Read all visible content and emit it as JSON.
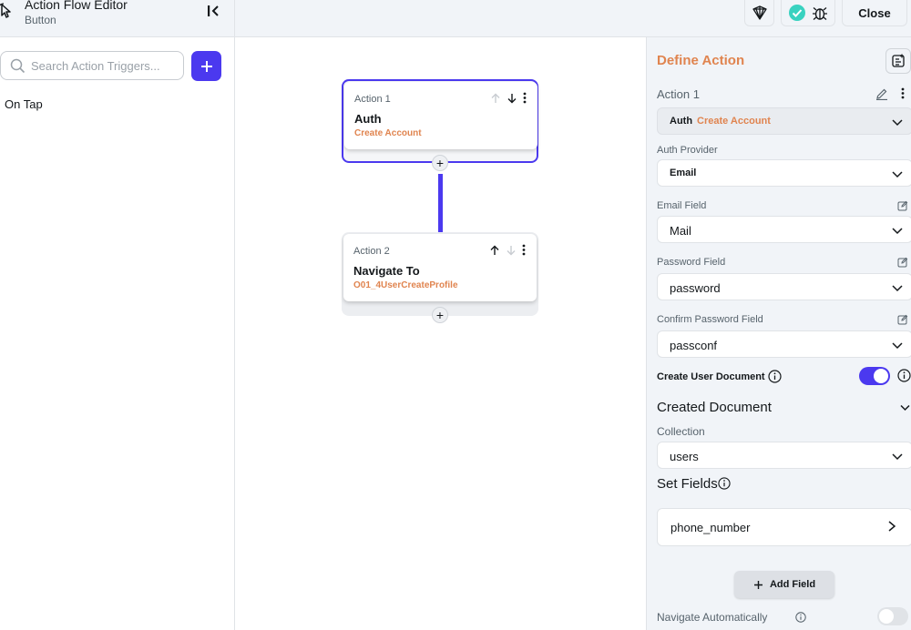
{
  "header": {
    "title": "Action Flow Editor",
    "subtitle": "Button",
    "close_label": "Close"
  },
  "left": {
    "search_placeholder": "Search Action Triggers...",
    "triggers": [
      "On Tap"
    ]
  },
  "canvas": {
    "actions": [
      {
        "num": "Action 1",
        "title": "Auth",
        "sub": "Create Account"
      },
      {
        "num": "Action 2",
        "title": "Navigate To",
        "sub": "O01_4UserCreateProfile"
      }
    ]
  },
  "panel": {
    "title": "Define Action",
    "action_label": "Action 1",
    "action_type": "Auth",
    "action_type_sub": "Create Account",
    "auth_provider_label": "Auth Provider",
    "auth_provider_value": "Email",
    "email_field_label": "Email Field",
    "email_field_value": "Mail",
    "password_field_label": "Password Field",
    "password_field_value": "password",
    "confirm_password_label": "Confirm Password Field",
    "confirm_password_value": "passconf",
    "create_user_doc_label": "Create User Document",
    "create_user_doc_enabled": true,
    "created_doc_heading": "Created Document",
    "collection_label": "Collection",
    "collection_value": "users",
    "set_fields_heading": "Set Fields",
    "fields": [
      "phone_number"
    ],
    "add_field_label": "Add Field",
    "navigate_auto_label": "Navigate Automatically",
    "navigate_auto_enabled": false
  },
  "colors": {
    "accent": "#4b39ef",
    "orange": "#e0844f",
    "success": "#39d2c0"
  }
}
